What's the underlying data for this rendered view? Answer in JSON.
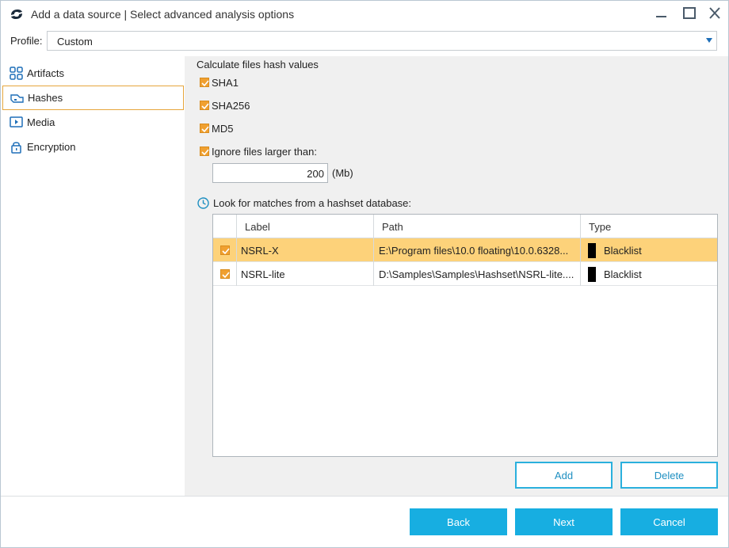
{
  "window": {
    "title": "Add a data source | Select advanced analysis options"
  },
  "profile": {
    "label": "Profile:",
    "value": "Custom"
  },
  "nav": {
    "items": [
      {
        "label": "Artifacts",
        "icon": "artifacts-icon"
      },
      {
        "label": "Hashes",
        "icon": "hashes-icon",
        "selected": true
      },
      {
        "label": "Media",
        "icon": "media-icon"
      },
      {
        "label": "Encryption",
        "icon": "lock-icon"
      }
    ]
  },
  "hash": {
    "title": "Calculate files hash values",
    "options": [
      {
        "label": "SHA1",
        "checked": true
      },
      {
        "label": "SHA256",
        "checked": true
      },
      {
        "label": "MD5",
        "checked": true
      },
      {
        "label": "Ignore files larger than:",
        "checked": true
      }
    ],
    "size_value": "200",
    "size_unit": "(Mb)"
  },
  "hashset": {
    "title": "Look for matches from a hashset database:",
    "columns": {
      "label": "Label",
      "path": "Path",
      "type": "Type"
    },
    "rows": [
      {
        "checked": true,
        "label": "NSRL-X",
        "path": "E:\\Program files\\10.0 floating\\10.0.6328...",
        "type": "Blacklist",
        "color": "#000000",
        "selected": true
      },
      {
        "checked": true,
        "label": "NSRL-lite",
        "path": "D:\\Samples\\Samples\\Hashset\\NSRL-lite....",
        "type": "Blacklist",
        "color": "#000000",
        "selected": false
      }
    ],
    "add_label": "Add",
    "delete_label": "Delete"
  },
  "footer": {
    "back_label": "Back",
    "next_label": "Next",
    "cancel_label": "Cancel"
  },
  "colors": {
    "accent": "#17aee1",
    "checkbox": "#f0a030",
    "selected_row": "#fdd27a"
  }
}
